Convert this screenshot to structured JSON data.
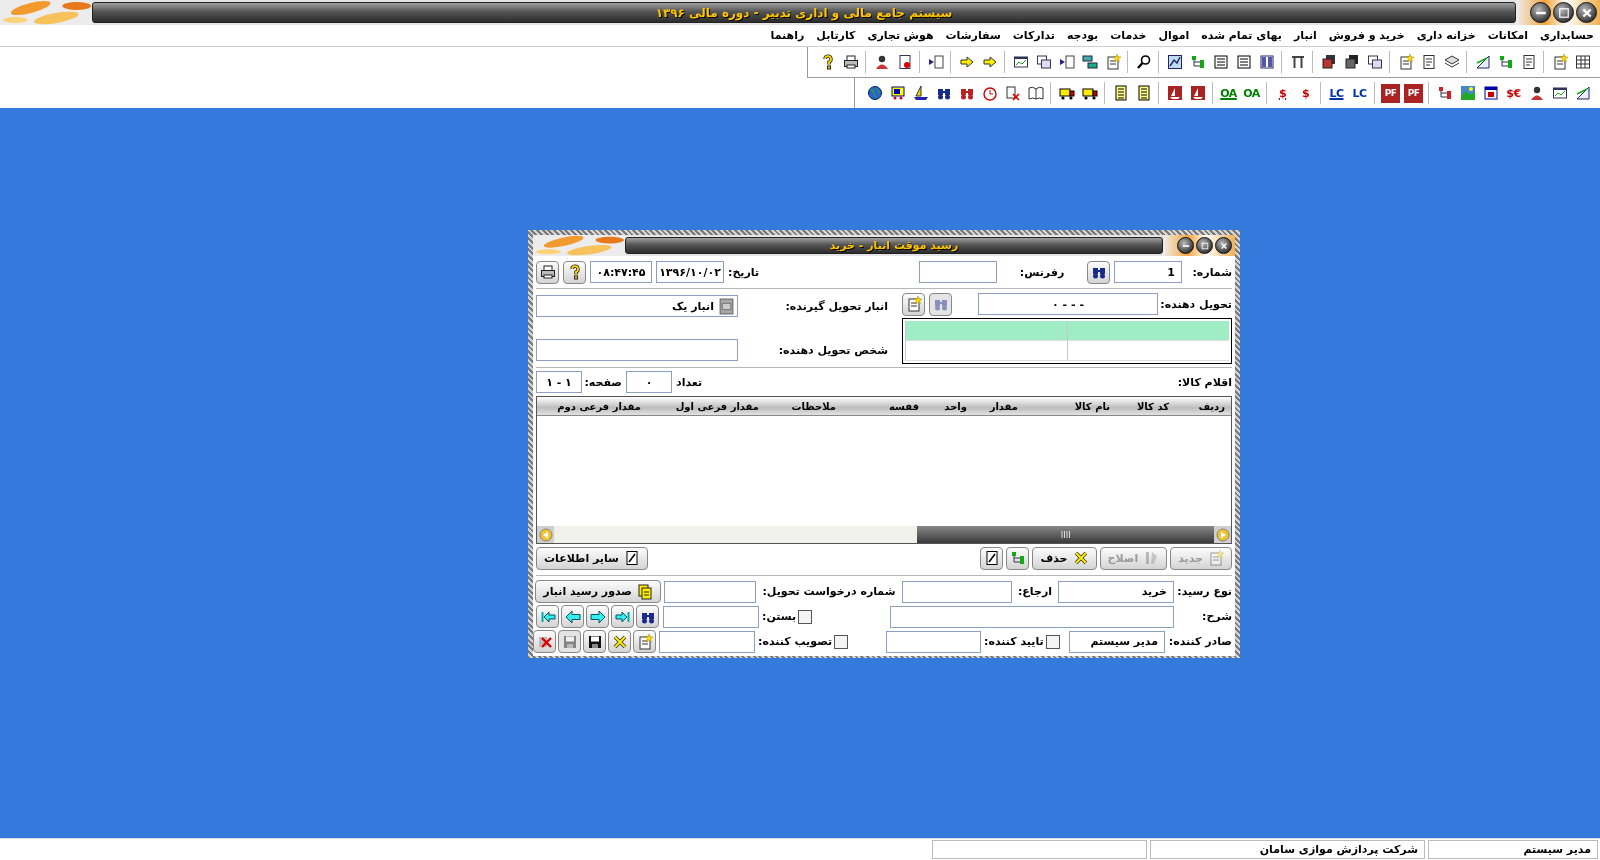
{
  "window": {
    "title": "سیستم جامع مالی و اداری تدبیر - دوره مالی ۱۳۹۶"
  },
  "menu": [
    {
      "label": "حسابداری"
    },
    {
      "label": "امکانات"
    },
    {
      "label": "خزانه داری"
    },
    {
      "label": "خرید و فروش"
    },
    {
      "label": "انبار"
    },
    {
      "label": "بهای تمام شده"
    },
    {
      "label": "اموال"
    },
    {
      "label": "خدمات"
    },
    {
      "label": "بودجه"
    },
    {
      "label": "تدارکات"
    },
    {
      "label": "سفارشات"
    },
    {
      "label": "هوش تجاری"
    },
    {
      "label": "کارتابل"
    },
    {
      "label": "راهنما"
    }
  ],
  "toolbars": [
    [
      [
        {
          "kind": "table"
        },
        {
          "kind": "doc-star"
        }
      ],
      [
        {
          "kind": "doc"
        },
        {
          "kind": "tree"
        },
        {
          "kind": "ruler"
        }
      ],
      [
        {
          "kind": "layers"
        },
        {
          "kind": "doc"
        },
        {
          "kind": "doc-star"
        }
      ],
      [
        {
          "kind": "windows"
        },
        {
          "kind": "stack"
        },
        {
          "kind": "stack-red"
        }
      ],
      [
        {
          "kind": "pi"
        }
      ],
      [
        {
          "kind": "columns"
        },
        {
          "kind": "list"
        },
        {
          "kind": "list"
        },
        {
          "kind": "tree"
        },
        {
          "kind": "chart"
        }
      ],
      [
        {
          "kind": "search"
        }
      ],
      [
        {
          "kind": "doc-star"
        },
        {
          "kind": "link"
        },
        {
          "kind": "arrow-doc"
        },
        {
          "kind": "windows"
        },
        {
          "kind": "window-chart"
        }
      ],
      [
        {
          "kind": "arrow-right"
        },
        {
          "kind": "arrow-yellow"
        }
      ],
      [
        {
          "kind": "arrow-doc"
        }
      ],
      [
        {
          "kind": "doc-red"
        },
        {
          "kind": "user"
        }
      ],
      [
        {
          "kind": "print"
        },
        {
          "kind": "help"
        }
      ]
    ],
    [
      [
        {
          "kind": "ruler"
        },
        {
          "kind": "window-chart"
        },
        {
          "kind": "user"
        },
        {
          "kind": "text",
          "label": "$€",
          "color": "#cc0000"
        },
        {
          "kind": "calendar"
        },
        {
          "kind": "landscape"
        },
        {
          "kind": "tree-red"
        }
      ],
      [
        {
          "kind": "text-box",
          "label": "PF",
          "color": "#aa2222"
        },
        {
          "kind": "text-box",
          "label": "PF",
          "color": "#aa2222"
        }
      ],
      [
        {
          "kind": "text",
          "label": "LC",
          "color": "#0033aa"
        },
        {
          "kind": "text-bar",
          "label": "LC",
          "color": "#0033aa"
        }
      ],
      [
        {
          "kind": "text",
          "label": "$",
          "color": "#cc0000"
        },
        {
          "kind": "text-bar",
          "label": "$",
          "color": "#cc0000"
        }
      ],
      [
        {
          "kind": "text",
          "label": "OA",
          "color": "#008000"
        },
        {
          "kind": "text-bar",
          "label": "OA",
          "color": "#008000"
        }
      ],
      [
        {
          "kind": "ship-red"
        },
        {
          "kind": "ship-red"
        }
      ],
      [
        {
          "kind": "calc"
        },
        {
          "kind": "calc"
        }
      ],
      [
        {
          "kind": "truck"
        },
        {
          "kind": "truck"
        }
      ],
      [
        {
          "kind": "book"
        },
        {
          "kind": "check"
        },
        {
          "kind": "clock"
        },
        {
          "kind": "binoculars-red"
        },
        {
          "kind": "binoculars"
        },
        {
          "kind": "ship"
        },
        {
          "kind": "truck-box"
        },
        {
          "kind": "globe"
        }
      ]
    ]
  ],
  "dialog": {
    "title": "رسید موقت انبار - خرید",
    "number": {
      "label": "شماره:",
      "value": "1"
    },
    "reference": {
      "label": "رفرنس:"
    },
    "date": {
      "label": "تاریخ:",
      "value": "۱۳۹۶/۱۰/۰۲"
    },
    "time": {
      "value": "۰۸:۴۷:۴۵"
    },
    "deliverer": {
      "label": "تحویل دهنده:",
      "value": "۰ - - -"
    },
    "deliverer_buttons": [
      {
        "kind": "find",
        "disabled": true
      },
      {
        "kind": "new",
        "disabled": false
      }
    ],
    "warehouse": {
      "label": "انبار تحویل گیرنده:",
      "value": "انبار یک"
    },
    "person": {
      "label": "شخص تحویل دهنده:"
    },
    "items_label": "اقلام کالا:",
    "count": {
      "label": "تعداد",
      "value": "۰"
    },
    "page": {
      "label": "صفحه:",
      "value": "۱ - ۱"
    },
    "table": {
      "columns": [
        "ردیف",
        "کد کالا",
        "نام کالا",
        "مقدار",
        "واحد",
        "قفسه",
        "ملاحظات",
        "مقدار فرعی اول",
        "مقدار فرعی دوم"
      ]
    },
    "actions": [
      {
        "kind": "new",
        "label": "جدید",
        "disabled": true
      },
      {
        "kind": "edit",
        "label": "اصلاح",
        "disabled": true
      },
      {
        "kind": "delete",
        "label": "حذف",
        "disabled": false
      },
      {
        "kind": "tree",
        "disabled": false
      },
      {
        "kind": "pencil",
        "disabled": false
      }
    ],
    "other_info": {
      "label": "سایر اطلاعات"
    },
    "form": {
      "receipt_type": {
        "label": "نوع رسید:",
        "value": "خرید"
      },
      "referral": {
        "label": "ارجاع:"
      },
      "request_number": {
        "label": "شماره درخواست تحویل:"
      },
      "issue_button": {
        "label": "صدور رسید انبار"
      },
      "description": {
        "label": "شرح:"
      },
      "close": {
        "label": "بستن:",
        "checked": false
      },
      "issuer": {
        "label": "صادر کننده:",
        "value": "مدیر سیستم"
      },
      "approver": {
        "label": "تایید کننده:",
        "checked": false
      },
      "ratifier": {
        "label": "تصویب کننده:",
        "checked": false
      }
    },
    "nav": [
      {
        "kind": "first",
        "disabled": false
      },
      {
        "kind": "prev",
        "disabled": false
      },
      {
        "kind": "next",
        "disabled": false
      },
      {
        "kind": "last",
        "disabled": false
      },
      {
        "kind": "find",
        "disabled": false
      }
    ],
    "record_buttons": [
      {
        "kind": "cancel",
        "disabled": false
      },
      {
        "kind": "save",
        "disabled": true
      },
      {
        "kind": "save",
        "disabled": false
      },
      {
        "kind": "delete",
        "disabled": false
      },
      {
        "kind": "new",
        "disabled": false
      }
    ]
  },
  "status_bar": [
    {
      "text": "مدیر سیستم"
    },
    {
      "text": "شرکت پردازش موازی سامان"
    }
  ]
}
